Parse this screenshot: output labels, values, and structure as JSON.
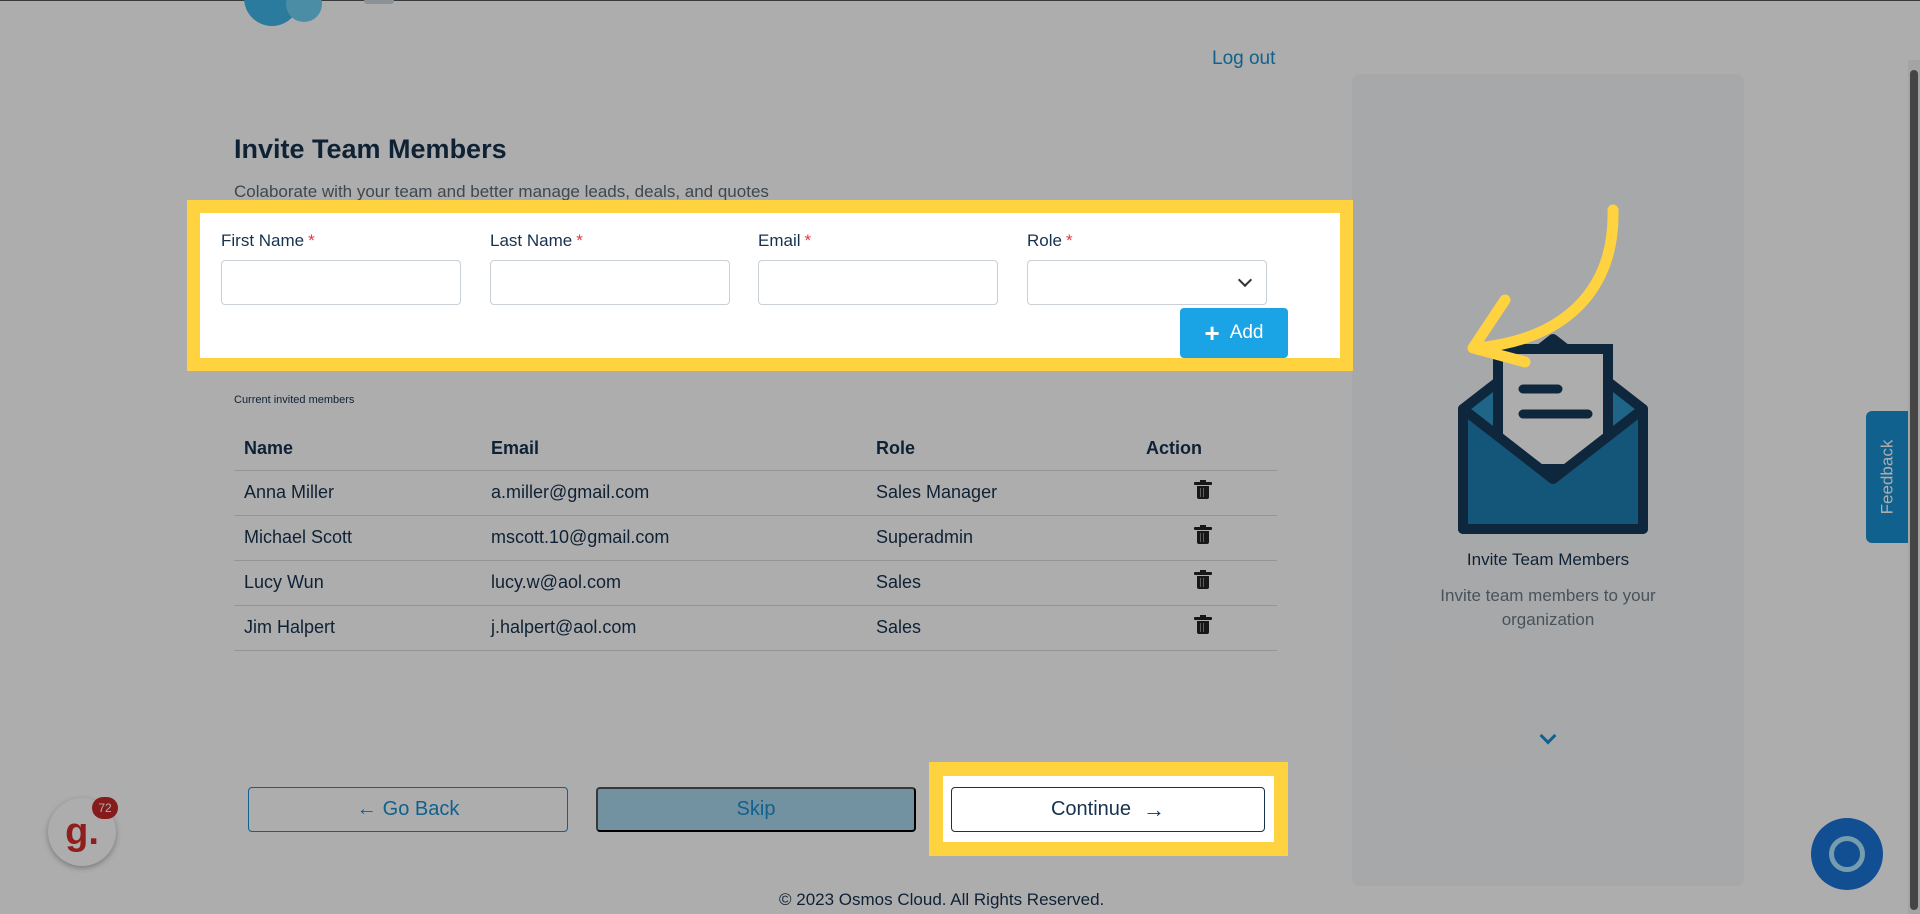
{
  "header": {
    "logout_label": "Log out"
  },
  "page": {
    "title": "Invite Team Members",
    "subtitle": "Colaborate with your team and better manage leads, deals, and quotes"
  },
  "form": {
    "first_name_label": "First Name",
    "last_name_label": "Last Name",
    "email_label": "Email",
    "role_label": "Role",
    "required_mark": "*",
    "first_name_value": "",
    "last_name_value": "",
    "email_value": "",
    "role_value": "",
    "add_label": "Add",
    "add_icon": "plus-icon"
  },
  "invited": {
    "label": "Current invited members",
    "headers": {
      "name": "Name",
      "email": "Email",
      "role": "Role",
      "action": "Action"
    },
    "rows": [
      {
        "name": "Anna Miller",
        "email": "a.miller@gmail.com",
        "role": "Sales Manager"
      },
      {
        "name": "Michael Scott",
        "email": "mscott.10@gmail.com",
        "role": "Superadmin"
      },
      {
        "name": "Lucy Wun",
        "email": "lucy.w@aol.com",
        "role": "Sales"
      },
      {
        "name": "Jim Halpert",
        "email": "j.halpert@aol.com",
        "role": "Sales"
      }
    ]
  },
  "nav": {
    "back_label": "Go Back",
    "skip_label": "Skip",
    "continue_label": "Continue"
  },
  "side_panel": {
    "title": "Invite Team Members",
    "subtitle": "Invite team members to your organization"
  },
  "widgets": {
    "feedback_label": "Feedback",
    "g_letter": "g.",
    "g_count": "72"
  },
  "footer": {
    "copyright": "© 2023 Osmos Cloud. All Rights Reserved."
  },
  "colors": {
    "accent": "#1aa4e5",
    "highlight": "#ffd23f",
    "text": "#17324e",
    "required": "#e8353e"
  }
}
